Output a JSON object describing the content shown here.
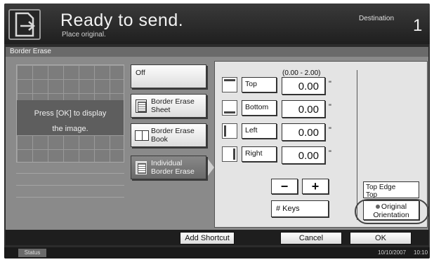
{
  "header": {
    "title": "Ready to send.",
    "subtitle": "Place original.",
    "destination_label": "Destination",
    "destination_count": "1"
  },
  "section": {
    "title": "Border Erase"
  },
  "preview": {
    "message_line1": "Press [OK] to display",
    "message_line2": "the image."
  },
  "options": {
    "off": "Off",
    "sheet_line1": "Border Erase",
    "sheet_line2": "Sheet",
    "book_line1": "Border Erase",
    "book_line2": "Book",
    "individual_line1": "Individual",
    "individual_line2": "Border Erase",
    "selected": "Individual Border Erase"
  },
  "settings": {
    "range": "(0.00 - 2.00)",
    "unit": "\"",
    "sides": [
      {
        "label": "Top",
        "value": "0.00"
      },
      {
        "label": "Bottom",
        "value": "0.00"
      },
      {
        "label": "Left",
        "value": "0.00"
      },
      {
        "label": "Right",
        "value": "0.00"
      }
    ],
    "minus_label": "−",
    "plus_label": "+",
    "numkeys_label": "# Keys",
    "edge_label_line1": "Top Edge",
    "edge_label_line2": "Top",
    "orientation_line1": "Original",
    "orientation_line2": "Orientation"
  },
  "bottom": {
    "add_shortcut": "Add Shortcut",
    "cancel": "Cancel",
    "ok": "OK"
  },
  "status_bar": {
    "status": "Status",
    "date": "10/10/2007",
    "time": "10:10"
  }
}
